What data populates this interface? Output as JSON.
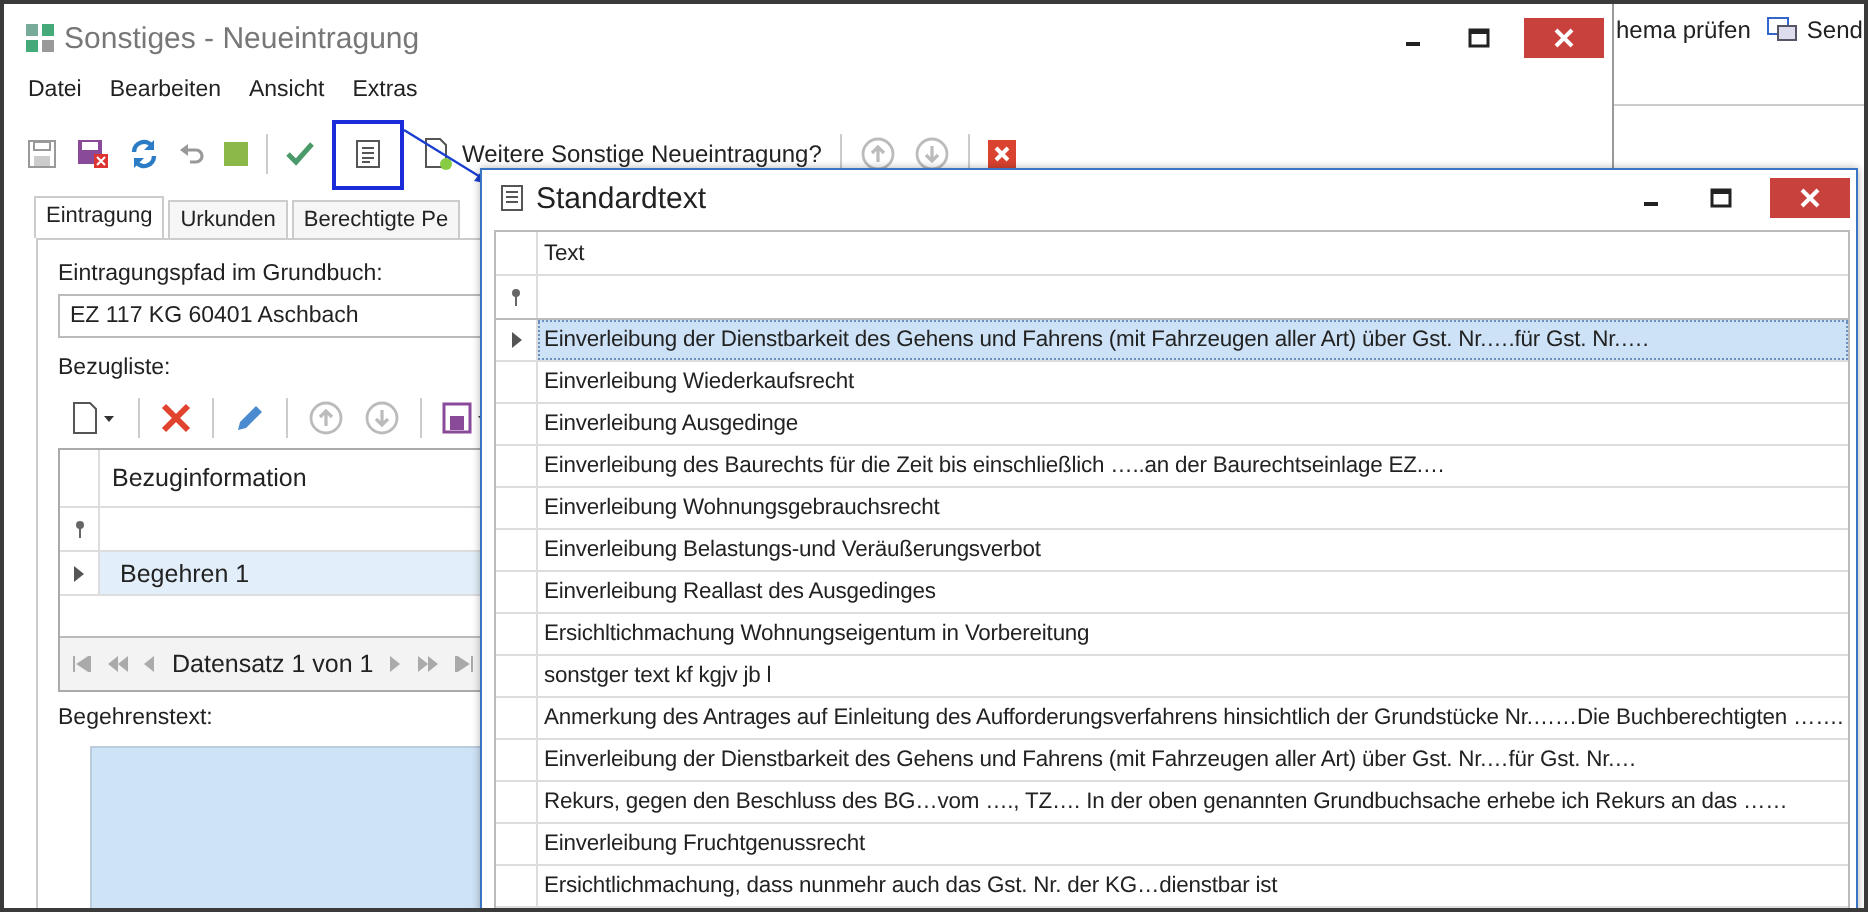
{
  "background_window": {
    "toolbar": [
      {
        "label": "hema prüfen",
        "kind": "text"
      },
      {
        "label": "Send",
        "kind": "icon"
      }
    ]
  },
  "main_window": {
    "title": "Sonstiges - Neueintragung",
    "menu": [
      "Datei",
      "Bearbeiten",
      "Ansicht",
      "Extras"
    ],
    "toolbar_prompt": "Weitere Sonstige Neueintragung?",
    "tabs": [
      {
        "label": "Eintragung",
        "selected": true
      },
      {
        "label": "Urkunden",
        "selected": false
      },
      {
        "label": "Berechtigte Pe",
        "selected": false
      }
    ],
    "path_label": "Eintragungspfad im Grundbuch:",
    "path_value": "EZ 117 KG 60401 Aschbach",
    "list_label": "Bezugliste:",
    "list_grid": {
      "column": "Bezuginformation",
      "rows": [
        {
          "text": "Begehren 1",
          "selected": true
        }
      ],
      "navigator": "Datensatz 1 von 1"
    },
    "request_label": "Begehrenstext:"
  },
  "dialog": {
    "title": "Standardtext",
    "column": "Text",
    "rows": [
      {
        "text": "Einverleibung der Dienstbarkeit des Gehens und Fahrens (mit Fahrzeugen aller Art) über Gst. Nr.….für Gst. Nr.….",
        "selected": true
      },
      {
        "text": "Einverleibung Wiederkaufsrecht",
        "selected": false
      },
      {
        "text": "Einverleibung Ausgedinge",
        "selected": false
      },
      {
        "text": "Einverleibung des Baurechts für die Zeit bis einschließlich …..an der Baurechtseinlage EZ.…",
        "selected": false
      },
      {
        "text": "Einverleibung Wohnungsgebrauchsrecht",
        "selected": false
      },
      {
        "text": "Einverleibung Belastungs-und Veräußerungsverbot",
        "selected": false
      },
      {
        "text": "Einverleibung Reallast des Ausgedinges",
        "selected": false
      },
      {
        "text": "Ersichltichmachung Wohnungseigentum in Vorbereitung",
        "selected": false
      },
      {
        "text": "sonstger text kf  kgjv jb l",
        "selected": false
      },
      {
        "text": "Anmerkung des Antrages auf Einleitung des Aufforderungsverfahrens hinsichtlich der Grundstücke Nr.……Die Buchberechtigten …….",
        "selected": false
      },
      {
        "text": "Einverleibung der Dienstbarkeit des Gehens und Fahrens (mit Fahrzeugen aller Art) über Gst. Nr.…für Gst. Nr.…",
        "selected": false
      },
      {
        "text": "Rekurs, gegen den Beschluss des BG…vom …., TZ…. In der oben genannten Grundbuchsache erhebe ich Rekurs an das ……",
        "selected": false
      },
      {
        "text": "Einverleibung Fruchtgenussrecht",
        "selected": false
      },
      {
        "text": "Ersichtlichmachung, dass nunmehr auch das Gst. Nr.  der KG…dienstbar ist",
        "selected": false
      }
    ]
  }
}
